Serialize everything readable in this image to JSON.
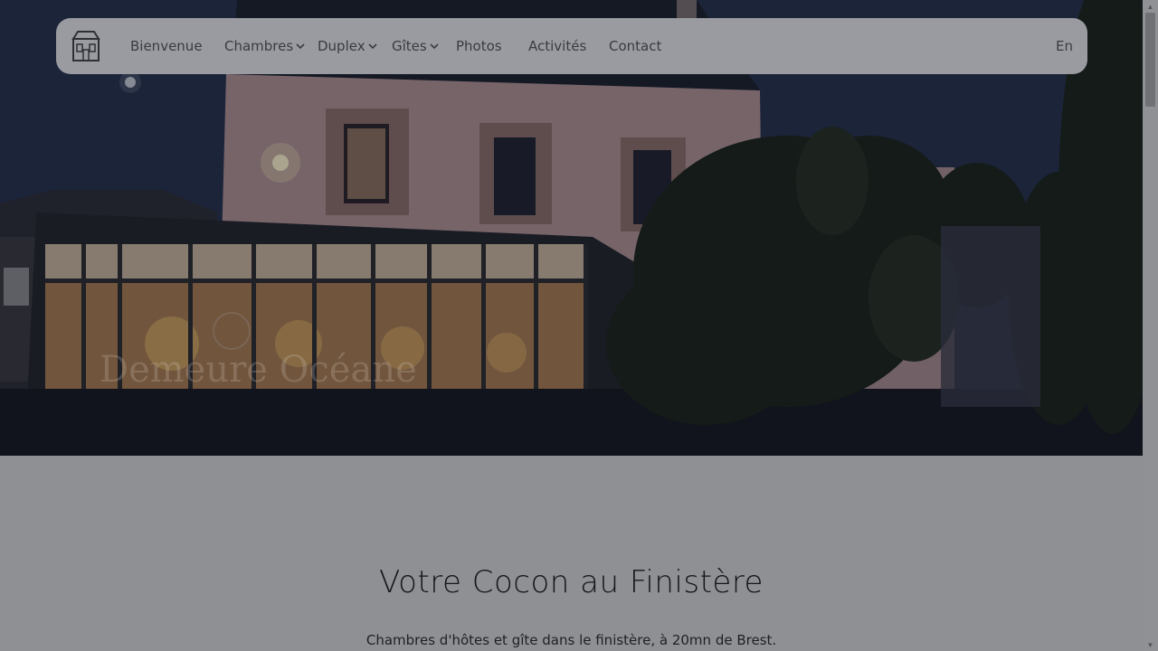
{
  "nav": {
    "items": [
      {
        "label": "Bienvenue",
        "dropdown": false
      },
      {
        "label": "Chambres",
        "dropdown": true
      },
      {
        "label": "Duplex",
        "dropdown": true
      },
      {
        "label": "Gîtes",
        "dropdown": true
      },
      {
        "label": "Photos",
        "dropdown": false
      },
      {
        "label": "Activités",
        "dropdown": false
      },
      {
        "label": "Contact",
        "dropdown": false
      }
    ],
    "lang": "En",
    "logo_icon": "house-icon"
  },
  "hero": {
    "watermark": "Demeure Océane"
  },
  "main": {
    "title": "Votre Cocon au Finistère",
    "subtitle": "Chambres d'hôtes et gîte dans le finistère, à 20mn de Brest."
  },
  "colors": {
    "overlay": "#9a9ba0",
    "page_bg": "#8e9094",
    "text_dark": "#151618"
  }
}
